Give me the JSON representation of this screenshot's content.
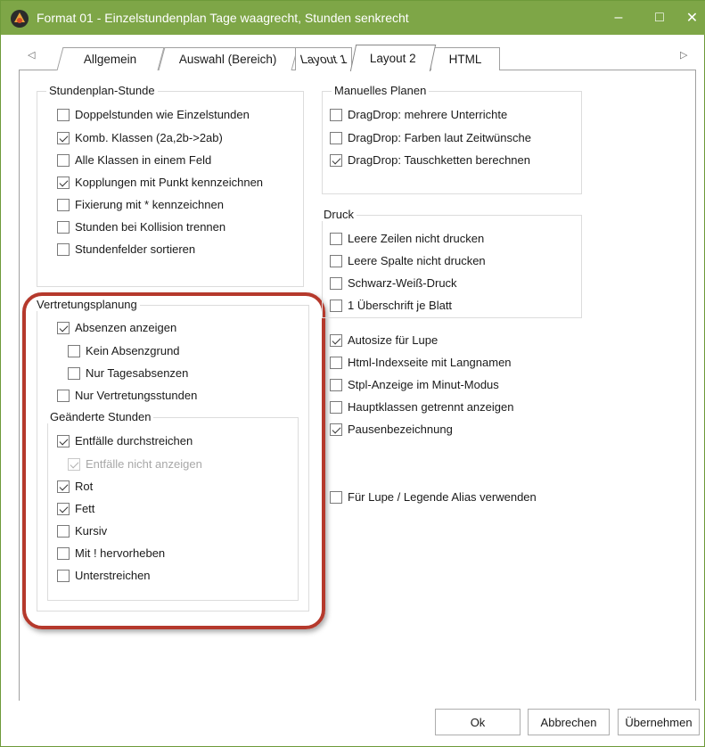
{
  "window": {
    "title": "Format 01 - Einzelstundenplan Tage waagrecht, Stunden senkrecht",
    "titlebar_color": "#7ea647",
    "controls": {
      "minimize": "–",
      "maximize": "□",
      "close": "✕"
    }
  },
  "tabs": {
    "left_arrow": "◁",
    "right_arrow": "▷",
    "items": [
      {
        "label": "Allgemein",
        "active": false
      },
      {
        "label": "Auswahl (Bereich)",
        "active": false
      },
      {
        "label": "Layout 1",
        "active": false
      },
      {
        "label": "Layout 2",
        "active": true
      },
      {
        "label": "HTML",
        "active": false
      }
    ]
  },
  "stundenplan_stunde": {
    "legend": "Stundenplan-Stunde",
    "options": [
      {
        "label": "Doppelstunden wie Einzelstunden",
        "checked": false
      },
      {
        "label": "Komb. Klassen (2a,2b->2ab)",
        "checked": true
      },
      {
        "label": "Alle Klassen in einem Feld",
        "checked": false
      },
      {
        "label": "Kopplungen mit Punkt kennzeichnen",
        "checked": true
      },
      {
        "label": "Fixierung mit * kennzeichnen",
        "checked": false
      },
      {
        "label": "Stunden bei Kollision trennen",
        "checked": false
      },
      {
        "label": "Stundenfelder sortieren",
        "checked": false
      }
    ]
  },
  "vertretungsplanung": {
    "legend": "Vertretungsplanung",
    "options": [
      {
        "label": "Absenzen anzeigen",
        "checked": true
      },
      {
        "label": "Kein Absenzgrund",
        "checked": false
      },
      {
        "label": "Nur Tagesabsenzen",
        "checked": false
      },
      {
        "label": "Nur Vertretungsstunden",
        "checked": false
      }
    ],
    "geaenderte_stunden": {
      "legend": "Geänderte Stunden",
      "options": [
        {
          "label": "Entfälle durchstreichen",
          "checked": true,
          "disabled": false
        },
        {
          "label": "Entfälle nicht anzeigen",
          "checked": true,
          "disabled": true
        },
        {
          "label": "Rot",
          "checked": true,
          "disabled": false
        },
        {
          "label": "Fett",
          "checked": true,
          "disabled": false
        },
        {
          "label": "Kursiv",
          "checked": false,
          "disabled": false
        },
        {
          "label": "Mit ! hervorheben",
          "checked": false,
          "disabled": false
        },
        {
          "label": "Unterstreichen",
          "checked": false,
          "disabled": false
        }
      ]
    }
  },
  "manuelles_planen": {
    "legend": "Manuelles Planen",
    "options": [
      {
        "label": "DragDrop: mehrere Unterrichte",
        "checked": false
      },
      {
        "label": "DragDrop: Farben laut Zeitwünsche",
        "checked": false
      },
      {
        "label": "DragDrop: Tauschketten berechnen",
        "checked": true
      }
    ]
  },
  "druck": {
    "legend": "Druck",
    "options": [
      {
        "label": "Leere Zeilen nicht drucken",
        "checked": false
      },
      {
        "label": "Leere Spalte nicht drucken",
        "checked": false
      },
      {
        "label": "Schwarz-Weiß-Druck",
        "checked": false
      },
      {
        "label": "1 Überschrift je Blatt",
        "checked": false
      }
    ]
  },
  "misc": {
    "options": [
      {
        "label": "Autosize für Lupe",
        "checked": true
      },
      {
        "label": "Html-Indexseite mit Langnamen",
        "checked": false
      },
      {
        "label": "Stpl-Anzeige im Minut-Modus",
        "checked": false
      },
      {
        "label": "Hauptklassen getrennt anzeigen",
        "checked": false
      },
      {
        "label": "Pausenbezeichnung",
        "checked": true
      }
    ],
    "alias_option": {
      "label": "Für Lupe / Legende Alias verwenden",
      "checked": false
    }
  },
  "buttons": {
    "ok": "Ok",
    "cancel": "Abbrechen",
    "apply": "Übernehmen"
  },
  "highlight_color": "#b5392c"
}
